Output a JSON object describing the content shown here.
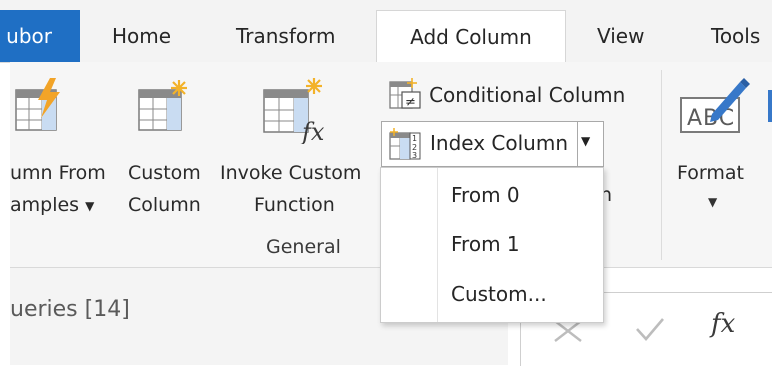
{
  "tabs": [
    "ubor",
    "Home",
    "Transform",
    "Add Column",
    "View",
    "Tools"
  ],
  "active_tab": "Add Column",
  "colors": {
    "file_tab": "#1f6fc4",
    "icon_blue": "#3778c9",
    "icon_light_blue": "#c9dcf2",
    "lightning": "#f2a428",
    "sparkle": "#f3b229"
  },
  "ribbon": {
    "column_from_examples": {
      "line1": "umn From",
      "line2": "amples"
    },
    "custom_column": {
      "line1": "Custom",
      "line2": "Column"
    },
    "invoke_custom_function": {
      "line1": "Invoke Custom",
      "line2": "Function"
    },
    "conditional_column": "Conditional Column",
    "index_column": "Index Column",
    "partial_hidden": "n",
    "format": "Format",
    "group_general": "General"
  },
  "index_menu": {
    "items": [
      "From 0",
      "From 1",
      "Custom..."
    ]
  },
  "left_pane": {
    "queries_label": "ueries [14]"
  },
  "formula_bar": {
    "fx": "fx"
  },
  "icons": [
    "lightning-icon",
    "sparkle-icon",
    "fx-icon",
    "conditional-column-icon",
    "index-column-icon",
    "abc-format-icon",
    "pencil-icon",
    "dropdown-arrow-icon",
    "cancel-x-icon",
    "check-icon"
  ]
}
